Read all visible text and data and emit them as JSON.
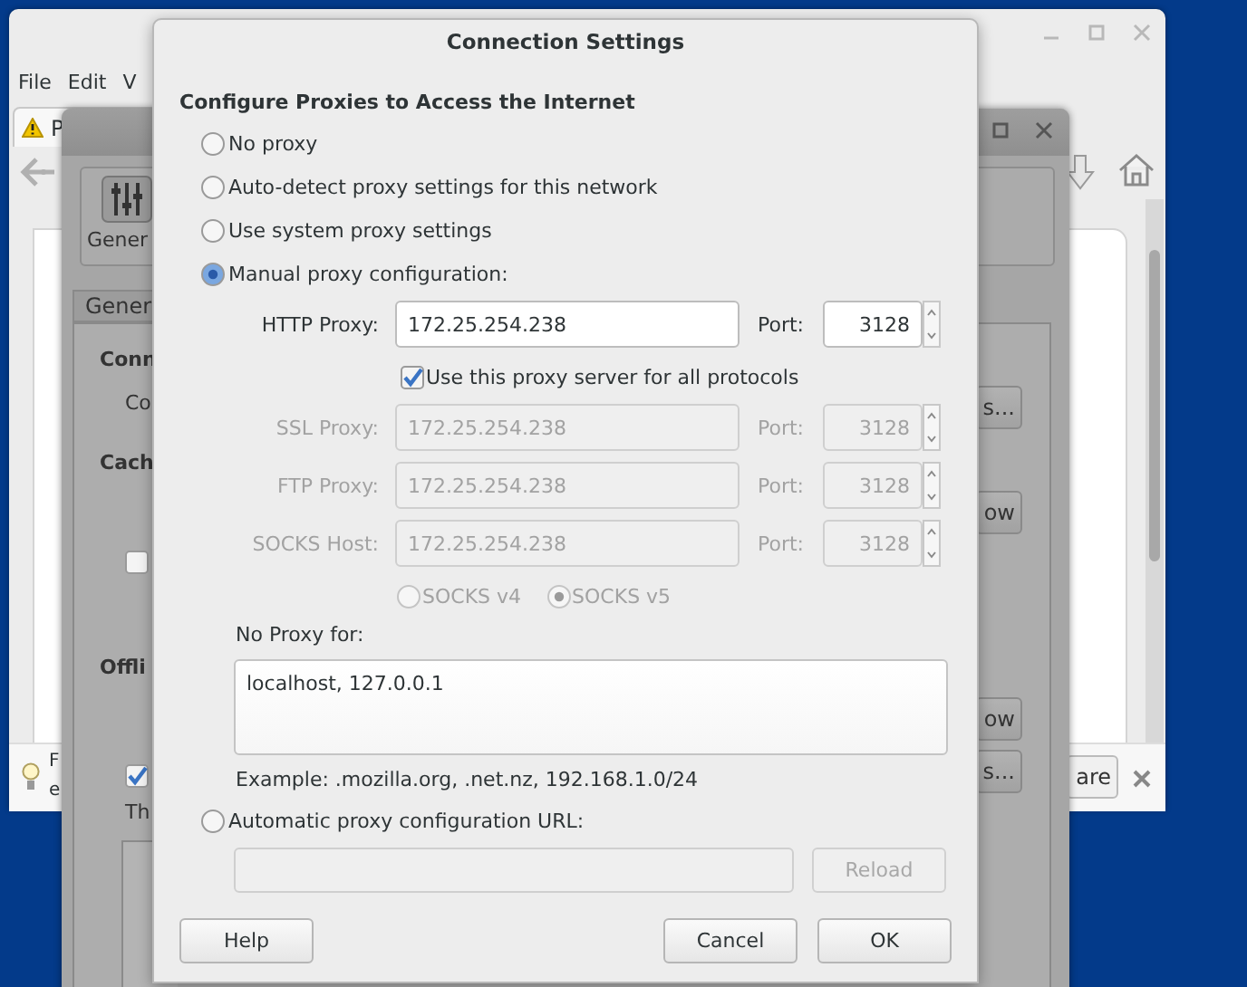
{
  "browser_window": {
    "menu": [
      "File",
      "Edit",
      "V"
    ],
    "tab_label": "P",
    "notification_lines": [
      "F",
      "e"
    ],
    "notification_button": "are"
  },
  "preferences_window": {
    "toolbar_label": "Gener",
    "tab_label": "Gener",
    "items": [
      {
        "kind": "heading",
        "text": "Conn"
      },
      {
        "kind": "label",
        "text": "Co"
      },
      {
        "kind": "heading",
        "text": "Cach"
      },
      {
        "kind": "checkbox",
        "checked": false
      },
      {
        "kind": "heading",
        "text": "Offli"
      },
      {
        "kind": "checkbox",
        "checked": true
      },
      {
        "kind": "label",
        "text": "Th"
      }
    ],
    "buttons": [
      "s...",
      "ow",
      "ow",
      "s..."
    ]
  },
  "dialog": {
    "title": "Connection Settings",
    "heading": "Configure Proxies to Access the Internet",
    "modes": [
      {
        "label": "No proxy",
        "selected": false
      },
      {
        "label": "Auto-detect proxy settings for this network",
        "selected": false
      },
      {
        "label": "Use system proxy settings",
        "selected": false
      },
      {
        "label": "Manual proxy configuration:",
        "selected": true
      }
    ],
    "proxies": [
      {
        "label": "HTTP Proxy:",
        "value": "172.25.254.238",
        "port_label": "Port:",
        "port": "3128",
        "disabled": false
      },
      {
        "label": "SSL Proxy:",
        "value": "172.25.254.238",
        "port_label": "Port:",
        "port": "3128",
        "disabled": true
      },
      {
        "label": "FTP Proxy:",
        "value": "172.25.254.238",
        "port_label": "Port:",
        "port": "3128",
        "disabled": true
      },
      {
        "label": "SOCKS Host:",
        "value": "172.25.254.238",
        "port_label": "Port:",
        "port": "3128",
        "disabled": true
      }
    ],
    "share_all": {
      "label": "Use this proxy server for all protocols",
      "checked": true
    },
    "socks_versions": {
      "disabled": true,
      "options": [
        {
          "label": "SOCKS v4",
          "selected": false
        },
        {
          "label": "SOCKS v5",
          "selected": true
        }
      ]
    },
    "no_proxy": {
      "label": "No Proxy for:",
      "value": "localhost, 127.0.0.1",
      "example": "Example: .mozilla.org, .net.nz, 192.168.1.0/24"
    },
    "auto_config": {
      "label": "Automatic proxy configuration URL:",
      "selected": false,
      "reload": "Reload",
      "reload_disabled": true
    },
    "buttons": [
      "Help",
      "Cancel",
      "OK"
    ]
  }
}
